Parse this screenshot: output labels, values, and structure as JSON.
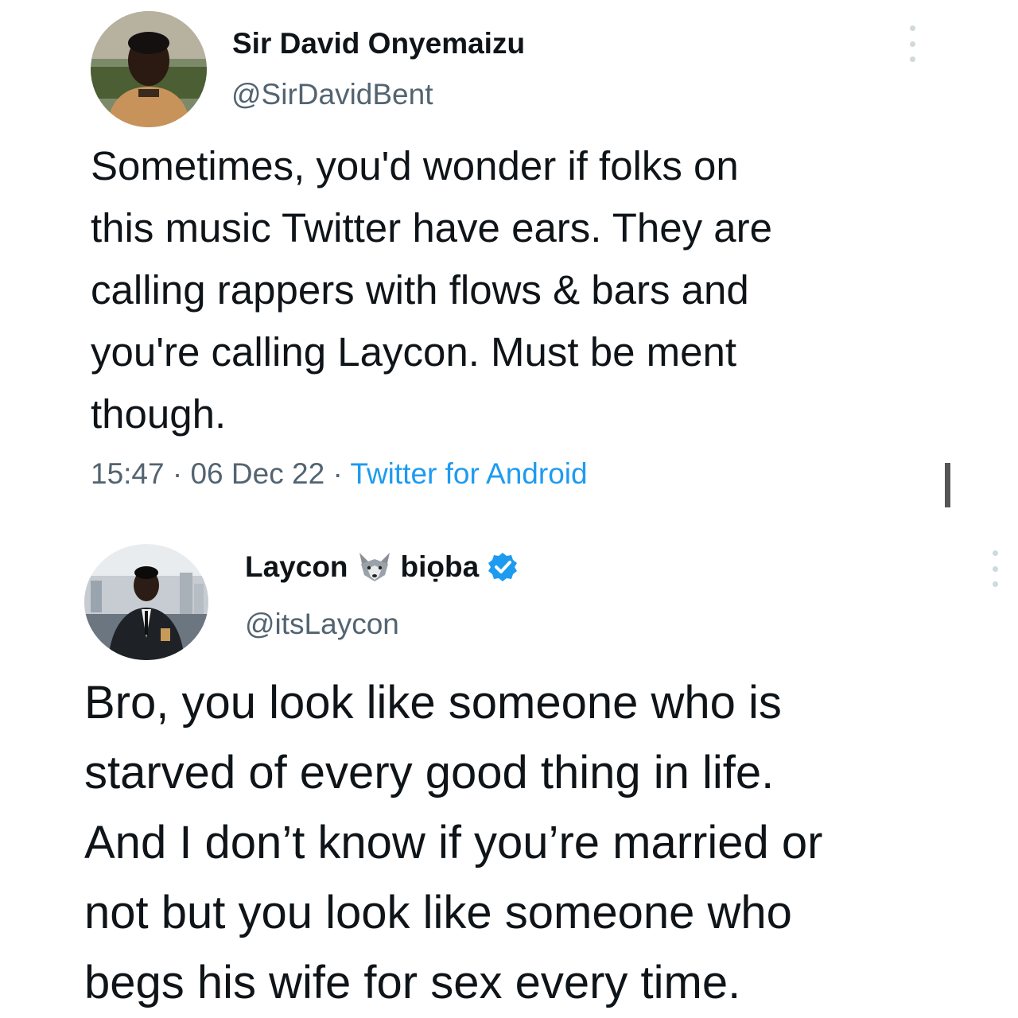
{
  "tweets": [
    {
      "display_name": "Sir David Onyemaizu",
      "handle": "@SirDavidBent",
      "text": "Sometimes, you'd wonder if folks on\nthis music Twitter have ears. They are\ncalling rappers with flows & bars and\nyou're calling Laycon. Must be ment\nthough.",
      "time": "15:47",
      "date": "06 Dec 22",
      "separator": "·",
      "source": "Twitter for Android",
      "avatar_icon": "profile-photo",
      "more_icon": "more-options-icon"
    },
    {
      "display_name_part1": "Laycon",
      "display_name_part2": "biọba",
      "name_emoji": "wolf-face-icon",
      "verified_icon": "verified-badge-icon",
      "handle": "@itsLaycon",
      "text": "Bro, you look like someone who is\nstarved of every good thing in life.\nAnd I don’t know if you’re married or\nnot but you look like someone who\nbegs his wife for sex every time.",
      "avatar_icon": "profile-photo",
      "more_icon": "more-options-icon"
    }
  ],
  "colors": {
    "text": "#0f1419",
    "secondary": "#536471",
    "link": "#1d9bf0",
    "verified": "#1d9bf0"
  }
}
